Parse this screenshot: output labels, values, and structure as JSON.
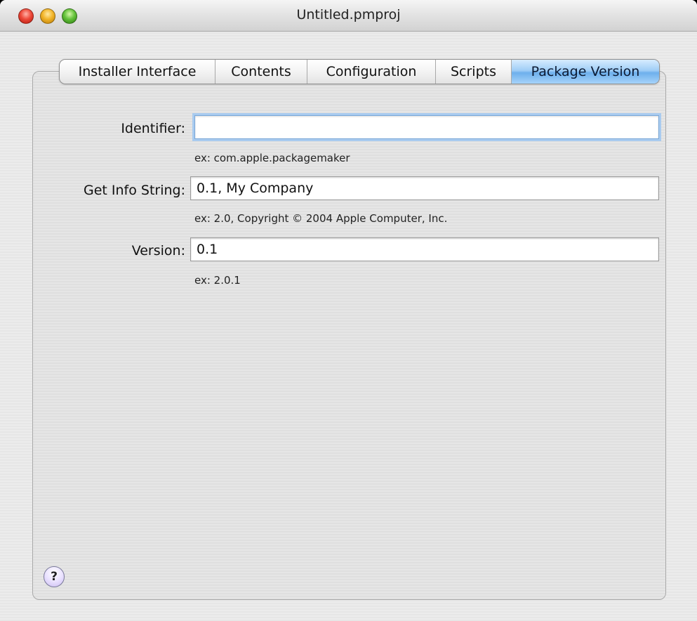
{
  "window": {
    "title": "Untitled.pmproj"
  },
  "tabs": [
    {
      "label": "Installer Interface",
      "selected": false
    },
    {
      "label": "Contents",
      "selected": false
    },
    {
      "label": "Configuration",
      "selected": false
    },
    {
      "label": "Scripts",
      "selected": false
    },
    {
      "label": "Package Version",
      "selected": true
    }
  ],
  "form": {
    "identifier": {
      "label": "Identifier:",
      "value": "",
      "hint": "ex: com.apple.packagemaker"
    },
    "get_info": {
      "label": "Get Info String:",
      "value": "0.1, My Company",
      "hint": "ex: 2.0, Copyright © 2004 Apple Computer, Inc."
    },
    "version": {
      "label": "Version:",
      "value": "0.1",
      "hint": "ex: 2.0.1"
    }
  },
  "help": {
    "glyph": "?"
  },
  "colors": {
    "accent": "#9fcdf6",
    "focus_ring": "#a9cbef"
  }
}
